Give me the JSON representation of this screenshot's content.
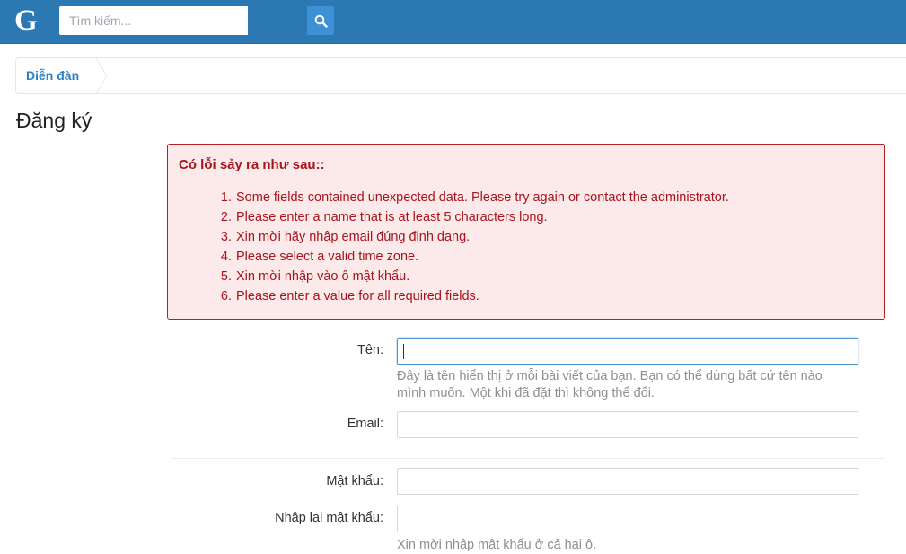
{
  "header": {
    "logo": "G",
    "search": {
      "placeholder": "Tìm kiếm...",
      "value": ""
    },
    "search_icon": "search-icon",
    "color": "#2c78b2"
  },
  "breadcrumb": {
    "items": [
      {
        "label": "Diễn đàn"
      }
    ]
  },
  "page": {
    "title": "Đăng ký"
  },
  "errors": {
    "title": "Có lỗi sảy ra như sau::",
    "items": [
      "Some fields contained unexpected data. Please try again or contact the administrator.",
      "Please enter a name that is at least 5 characters long.",
      "Xin mời hãy nhập email đúng định dạng.",
      "Please select a valid time zone.",
      "Xin mời nhập vào ô mật khẩu.",
      "Please enter a value for all required fields."
    ],
    "color": "#a7141d"
  },
  "form": {
    "name": {
      "label": "Tên:",
      "value": "",
      "hint": "Đây là tên hiển thị ở mỗi bài viết của bạn. Bạn có thể dùng bất cứ tên nào mình muốn. Một khi đã đặt thì không thể đổi."
    },
    "email": {
      "label": "Email:",
      "value": ""
    },
    "password": {
      "label": "Mật khẩu:",
      "value": ""
    },
    "password_confirm": {
      "label": "Nhập lại mật khẩu:",
      "value": "",
      "hint": "Xin mời nhập mật khẩu ở cả hai ô."
    }
  }
}
